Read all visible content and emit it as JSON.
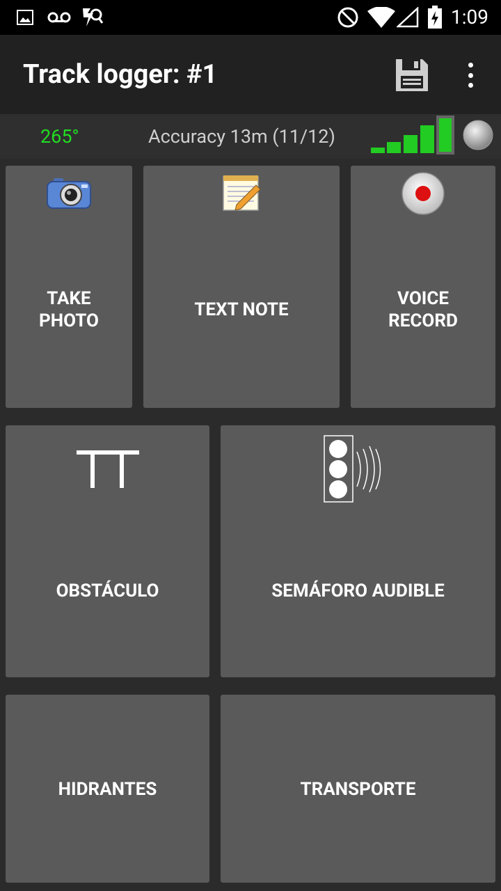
{
  "status_bar": {
    "time": "1:09",
    "icons": [
      "image-icon",
      "voicemail-icon",
      "app-notification-icon",
      "do-not-disturb-icon",
      "wifi-icon",
      "cell-signal-icon",
      "battery-charging-icon"
    ]
  },
  "app_bar": {
    "title": "Track logger: #1",
    "actions": [
      "save-icon",
      "more-vert-icon"
    ]
  },
  "info_bar": {
    "heading": "265°",
    "accuracy": "Accuracy 13m (11/12)",
    "gps_signal_bars": 5,
    "colors": {
      "heading": "#22dd22",
      "signal": "#22dd22"
    }
  },
  "tiles": {
    "take_photo": {
      "label_line1": "TAKE",
      "label_line2": "PHOTO",
      "icon": "camera-icon"
    },
    "text_note": {
      "label": "TEXT NOTE",
      "icon": "notepad-icon"
    },
    "voice_record": {
      "label_line1": "VOICE",
      "label_line2": "RECORD",
      "icon": "record-icon"
    },
    "obstaculo": {
      "label": "OBSTÁCULO",
      "icon": "obstacle-icon"
    },
    "semaforo": {
      "label": "SEMÁFORO AUDIBLE",
      "icon": "audible-traffic-light-icon"
    },
    "hidrantes": {
      "label": "HIDRANTES"
    },
    "transporte": {
      "label": "TRANSPORTE"
    }
  }
}
